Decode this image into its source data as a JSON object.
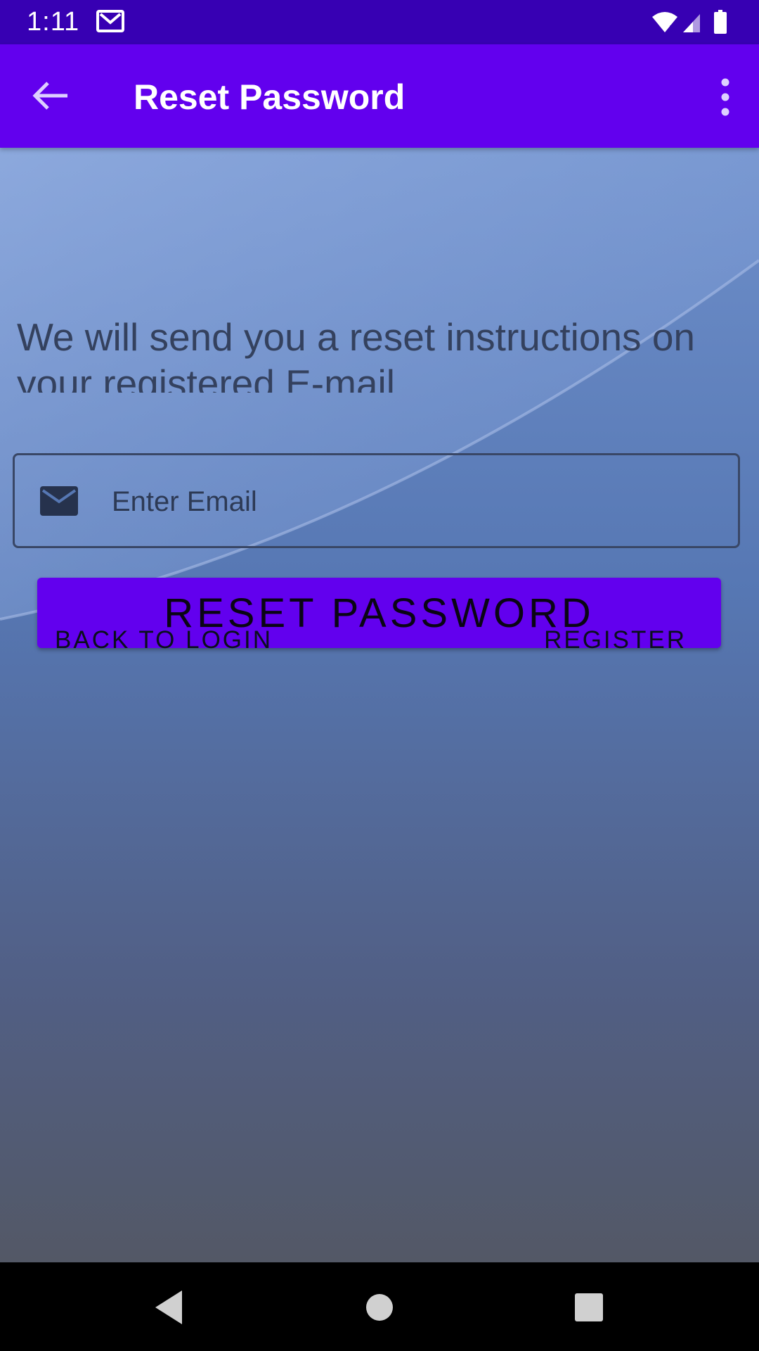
{
  "status_bar": {
    "time": "1:11",
    "icons": [
      "gmail-icon",
      "wifi-icon",
      "signal-icon",
      "battery-icon"
    ]
  },
  "app_bar": {
    "title": "Reset Password",
    "back_icon": "arrow-back-icon",
    "menu_icon": "more-vert-icon"
  },
  "main": {
    "instructions": "We will send you a reset instructions on your registered E-mail",
    "email_field": {
      "icon": "mail-icon",
      "placeholder": "Enter Email",
      "value": ""
    },
    "reset_button": "RESET PASSWORD",
    "back_to_login": "BACK TO LOGIN",
    "register": "REGISTER"
  },
  "nav_bar": {
    "buttons": [
      "back-triangle-icon",
      "home-circle-icon",
      "recents-square-icon"
    ]
  },
  "colors": {
    "status_bar": "#3700b3",
    "primary": "#6200ee"
  }
}
